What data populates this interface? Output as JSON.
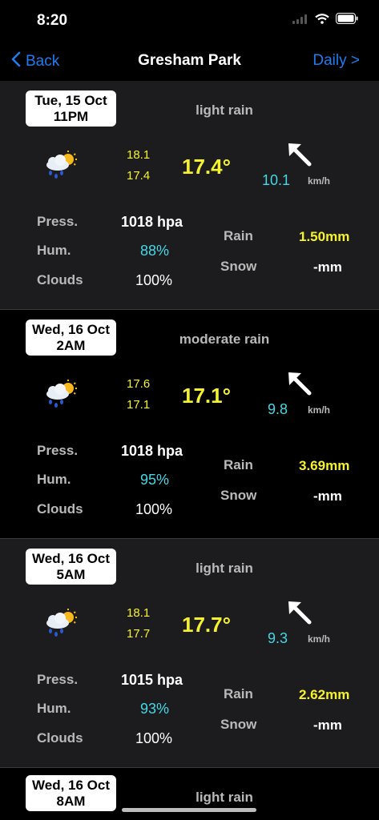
{
  "status": {
    "time": "8:20"
  },
  "nav": {
    "back_label": "Back",
    "title": "Gresham Park",
    "daily_label": "Daily >"
  },
  "labels": {
    "press": "Press.",
    "hum": "Hum.",
    "clouds": "Clouds",
    "rain": "Rain",
    "snow": "Snow",
    "wind_unit": "km/h"
  },
  "cards": [
    {
      "date": "Tue, 15 Oct",
      "hour": "11PM",
      "desc": "light rain",
      "tmax": "18.1",
      "tmin": "17.4",
      "temp": "17.4°",
      "wind": "10.1",
      "press": "1018 hpa",
      "hum": "88%",
      "clouds": "100%",
      "rain": "1.50mm",
      "snow": "-mm"
    },
    {
      "date": "Wed, 16 Oct",
      "hour": "2AM",
      "desc": "moderate rain",
      "tmax": "17.6",
      "tmin": "17.1",
      "temp": "17.1°",
      "wind": "9.8",
      "press": "1018 hpa",
      "hum": "95%",
      "clouds": "100%",
      "rain": "3.69mm",
      "snow": "-mm"
    },
    {
      "date": "Wed, 16 Oct",
      "hour": "5AM",
      "desc": "light rain",
      "tmax": "18.1",
      "tmin": "17.7",
      "temp": "17.7°",
      "wind": "9.3",
      "press": "1015 hpa",
      "hum": "93%",
      "clouds": "100%",
      "rain": "2.62mm",
      "snow": "-mm"
    },
    {
      "date": "Wed, 16 Oct",
      "hour": "8AM",
      "desc": "light rain"
    }
  ]
}
